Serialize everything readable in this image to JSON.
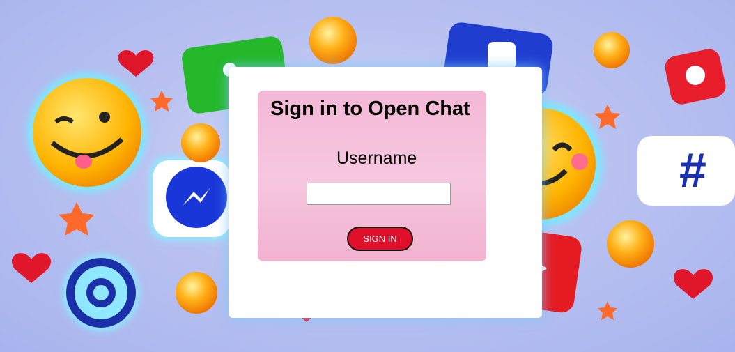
{
  "login": {
    "title": "Sign in to Open Chat",
    "username_label": "Username",
    "username_value": "",
    "username_placeholder": "",
    "submit_label": "SIGN IN"
  },
  "colors": {
    "button": "#e0102a",
    "panel": "#ffffff",
    "panel_inner": "#f3b8d6",
    "background": "#b9c2f0"
  },
  "decorations": {
    "icons": [
      "wink-emoji-icon",
      "smile-emoji-icon",
      "messenger-icon",
      "at-sign-icon",
      "hashtag-icon",
      "location-pin-icon",
      "like-thumb-icon",
      "chat-bubble-icon",
      "play-icon",
      "heart-icon",
      "star-icon",
      "orb-icon"
    ]
  }
}
